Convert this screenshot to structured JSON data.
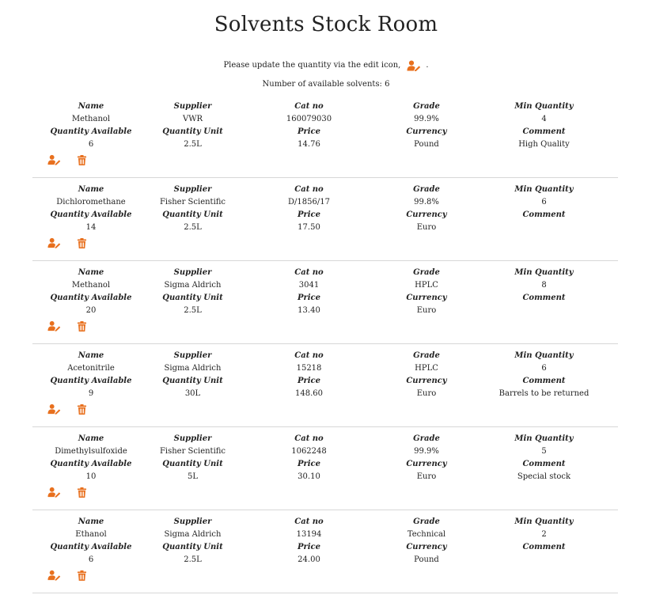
{
  "page": {
    "title": "Solvents Stock Room",
    "instruction": "Please update the quantity via the edit icon,",
    "instruction_suffix": ".",
    "count_text": "Number of available solvents: 6"
  },
  "labels": {
    "name": "Name",
    "supplier": "Supplier",
    "cat_no": "Cat no",
    "grade": "Grade",
    "min_quantity": "Min Quantity",
    "quantity_available": "Quantity Available",
    "quantity_unit": "Quantity Unit",
    "price": "Price",
    "currency": "Currency",
    "comment": "Comment"
  },
  "icons": {
    "edit": "user-edit-icon",
    "delete": "trash-icon",
    "accent_color": "#e8701e"
  },
  "solvents": [
    {
      "name": "Methanol",
      "supplier": "VWR",
      "cat_no": "160079030",
      "grade": "99.9%",
      "min_quantity": "4",
      "quantity_available": "6",
      "quantity_unit": "2.5L",
      "price": "14.76",
      "currency": "Pound",
      "comment": "High Quality"
    },
    {
      "name": "Dichloromethane",
      "supplier": "Fisher Scientific",
      "cat_no": "D/1856/17",
      "grade": "99.8%",
      "min_quantity": "6",
      "quantity_available": "14",
      "quantity_unit": "2.5L",
      "price": "17.50",
      "currency": "Euro",
      "comment": ""
    },
    {
      "name": "Methanol",
      "supplier": "Sigma Aldrich",
      "cat_no": "3041",
      "grade": "HPLC",
      "min_quantity": "8",
      "quantity_available": "20",
      "quantity_unit": "2.5L",
      "price": "13.40",
      "currency": "Euro",
      "comment": ""
    },
    {
      "name": "Acetonitrile",
      "supplier": "Sigma Aldrich",
      "cat_no": "15218",
      "grade": "HPLC",
      "min_quantity": "6",
      "quantity_available": "9",
      "quantity_unit": "30L",
      "price": "148.60",
      "currency": "Euro",
      "comment": "Barrels to be returned"
    },
    {
      "name": "Dimethylsulfoxide",
      "supplier": "Fisher Scientific",
      "cat_no": "1062248",
      "grade": "99.9%",
      "min_quantity": "5",
      "quantity_available": "10",
      "quantity_unit": "5L",
      "price": "30.10",
      "currency": "Euro",
      "comment": "Special stock"
    },
    {
      "name": "Ethanol",
      "supplier": "Sigma Aldrich",
      "cat_no": "13194",
      "grade": "Technical",
      "min_quantity": "2",
      "quantity_available": "6",
      "quantity_unit": "2.5L",
      "price": "24.00",
      "currency": "Pound",
      "comment": ""
    }
  ]
}
